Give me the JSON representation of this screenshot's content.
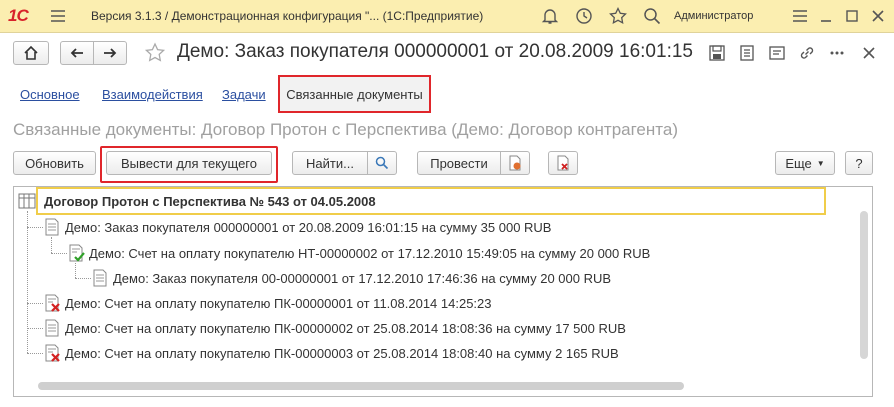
{
  "app": {
    "logo": "1С",
    "window_title": "Версия 3.1.3 / Демонстрационная конфигурация \"... (1С:Предприятие)",
    "user": "Администратор"
  },
  "document": {
    "title": "Демо: Заказ покупателя 000000001 от 20.08.2009 16:01:15"
  },
  "tabs": [
    {
      "label": "Основное"
    },
    {
      "label": "Взаимодействия"
    },
    {
      "label": "Задачи"
    },
    {
      "label": "Связанные документы"
    }
  ],
  "section_title": "Связанные документы: Договор Протон с Перспектива (Демо: Договор контрагента)",
  "toolbar": {
    "refresh": "Обновить",
    "show_current": "Вывести для текущего",
    "find": "Найти...",
    "post": "Провести",
    "more": "Еще",
    "help": "?"
  },
  "tree": {
    "root": "Договор Протон с Перспектива № 543 от 04.05.2008",
    "items": [
      {
        "text": "Демо: Заказ покупателя 000000001 от 20.08.2009 16:01:15 на сумму 35 000 RUB",
        "icon": "document-icon"
      },
      {
        "text": "Демо: Счет на оплату покупателю НТ-00000002 от 17.12.2010 15:49:05 на сумму 20 000 RUB",
        "icon": "document-posted-icon"
      },
      {
        "text": "Демо: Заказ покупателя 00-00000001 от 17.12.2010 17:46:36 на сумму 20 000 RUB",
        "icon": "document-icon"
      },
      {
        "text": "Демо: Счет на оплату покупателю ПК-00000001 от 11.08.2014 14:25:23",
        "icon": "document-deleted-icon"
      },
      {
        "text": "Демо: Счет на оплату покупателю ПК-00000002 от 25.08.2014 18:08:36 на сумму 17 500 RUB",
        "icon": "document-icon"
      },
      {
        "text": "Демо: Счет на оплату покупателю ПК-00000003 от 25.08.2014 18:08:40 на сумму 2 165 RUB",
        "icon": "document-deleted-icon"
      }
    ]
  }
}
